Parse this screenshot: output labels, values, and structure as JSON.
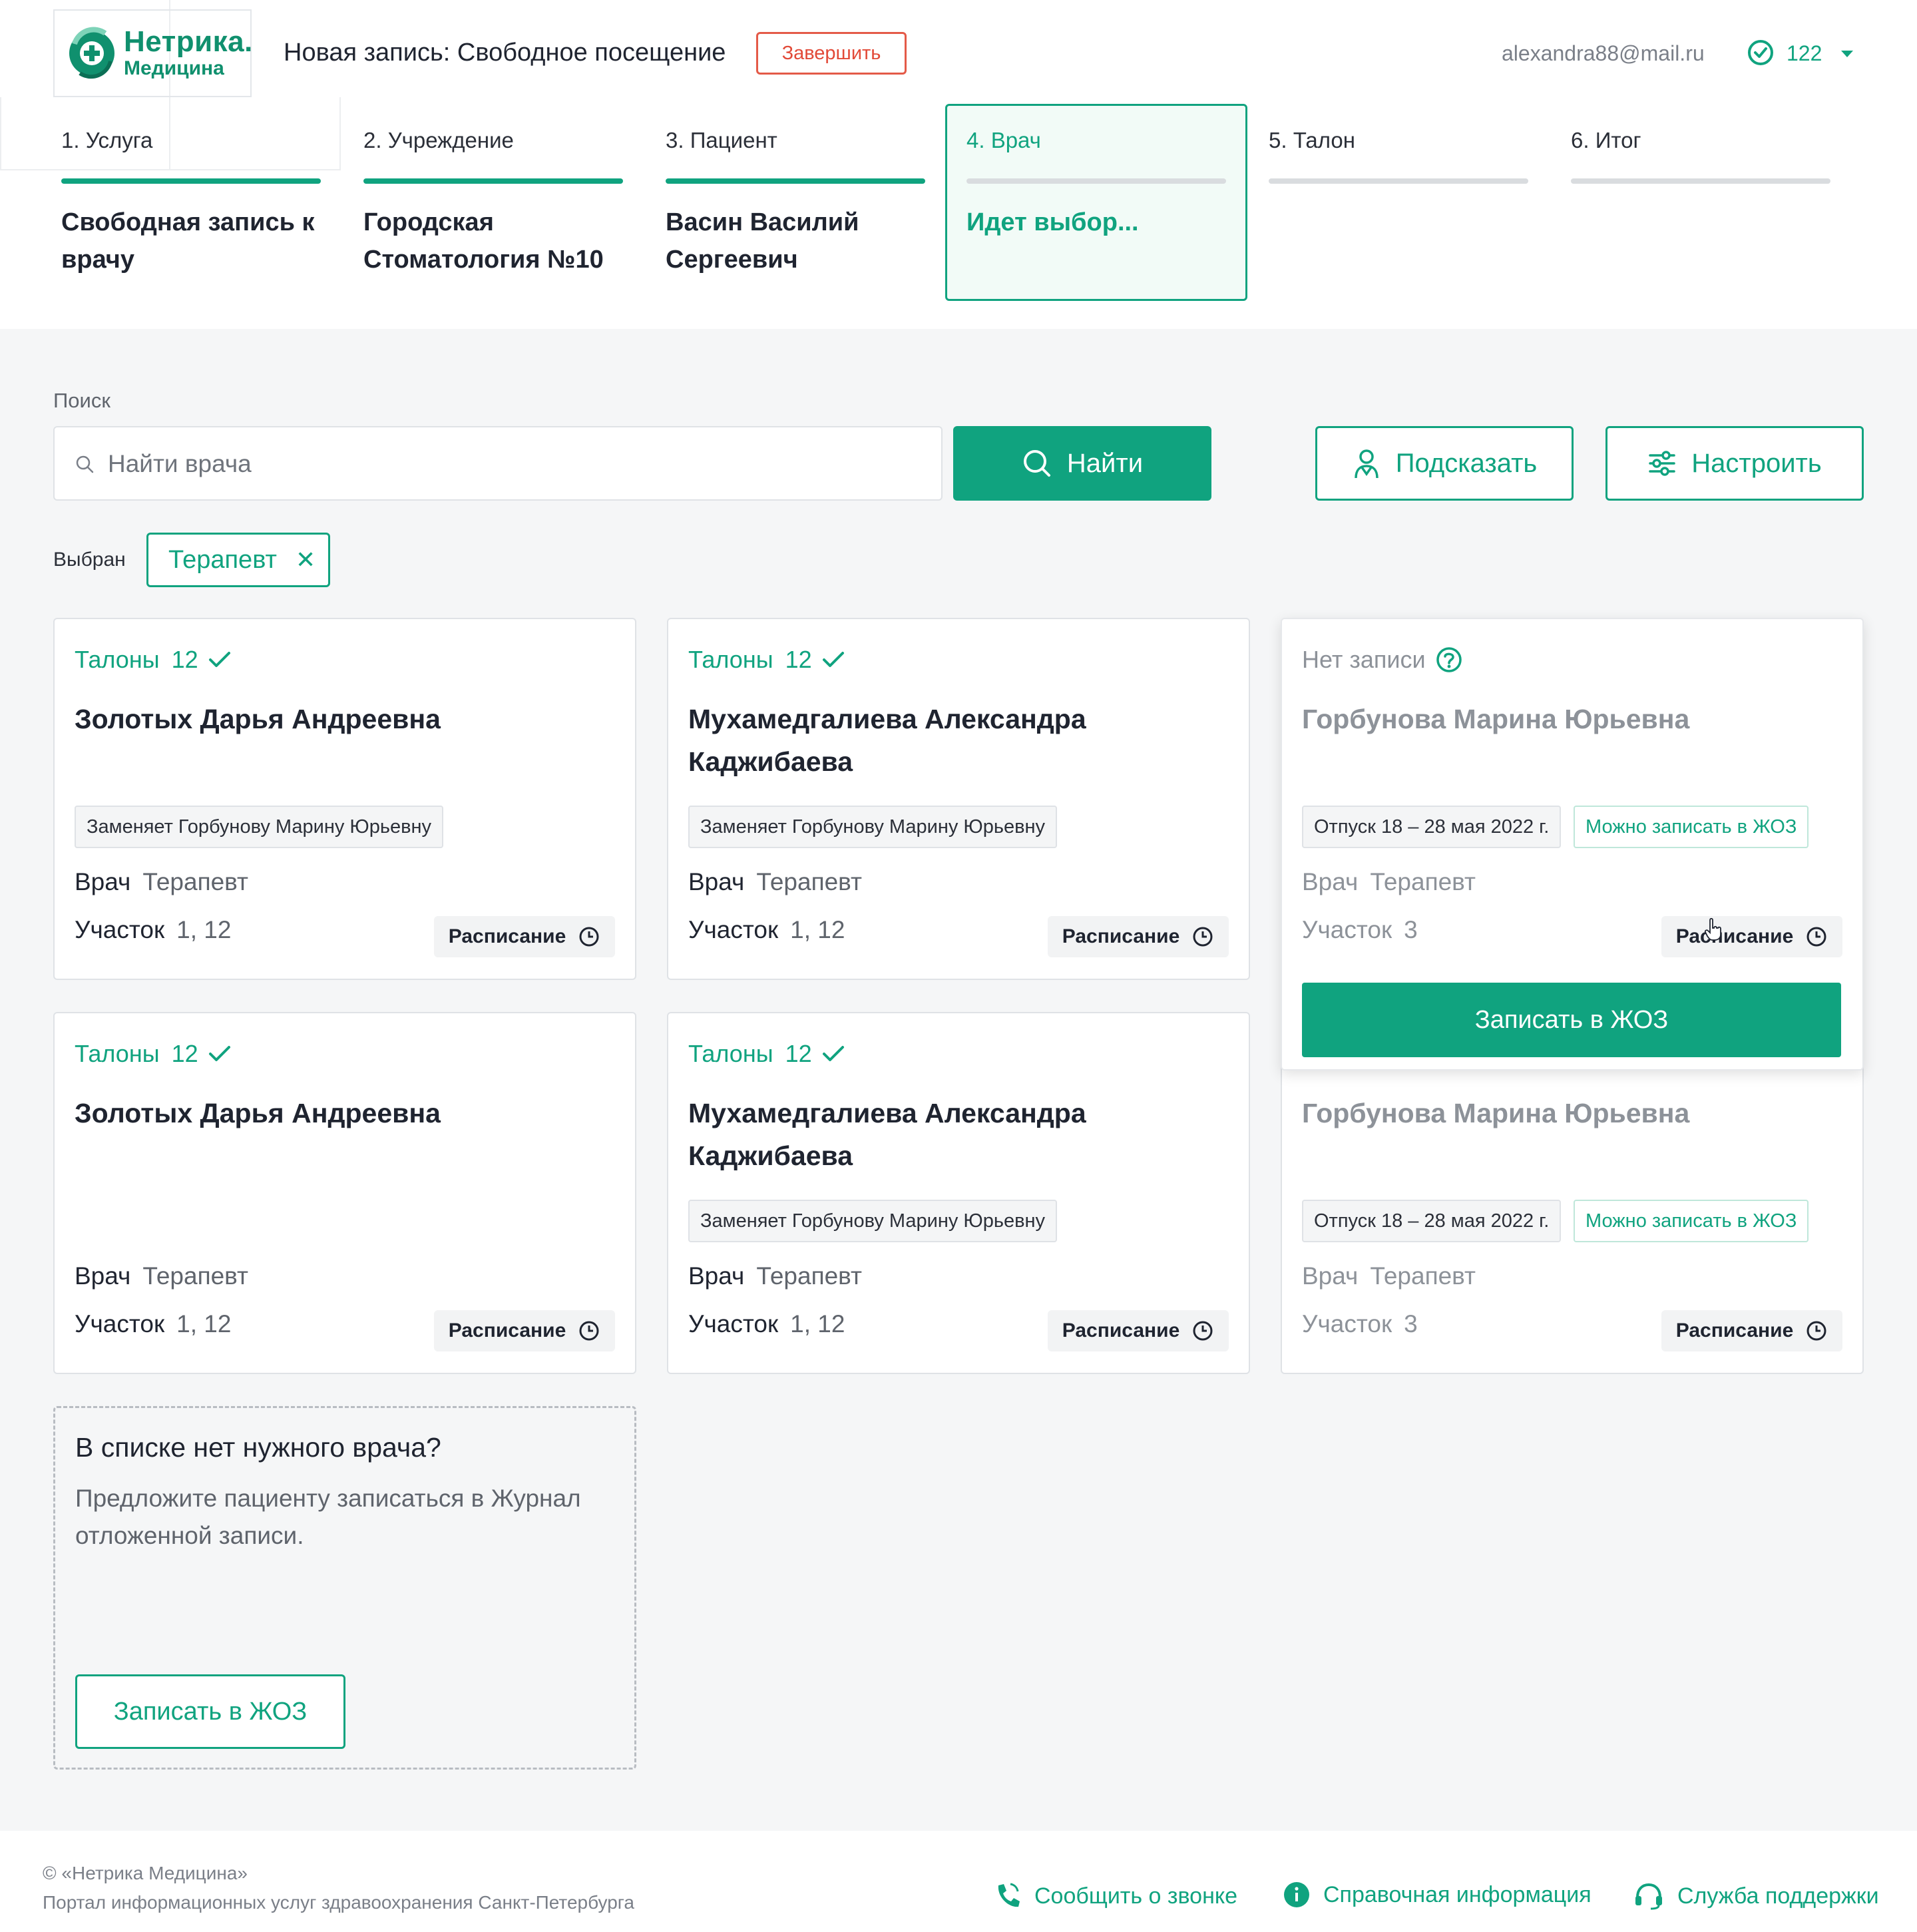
{
  "logo": {
    "line1": "Нетрика.",
    "line2": "Медицина"
  },
  "header": {
    "title": "Новая запись: Свободное посещение",
    "finish_label": "Завершить",
    "email": "alexandra88@mail.ru",
    "count": "122"
  },
  "steps": [
    {
      "label": "1. Услуга",
      "value": "Свободная запись к врачу",
      "state": "done"
    },
    {
      "label": "2. Учреждение",
      "value": "Городская Стоматология №10",
      "state": "done"
    },
    {
      "label": "3. Пациент",
      "value": "Васин Василий Сергеевич",
      "state": "done"
    },
    {
      "label": "4. Врач",
      "value": "Идет выбор...",
      "state": "active"
    },
    {
      "label": "5. Талон",
      "value": "",
      "state": "pending"
    },
    {
      "label": "6. Итог",
      "value": "",
      "state": "pending"
    }
  ],
  "search": {
    "label": "Поиск",
    "placeholder": "Найти врача",
    "find_label": "Найти",
    "suggest_label": "Подсказать",
    "configure_label": "Настроить"
  },
  "filter": {
    "label": "Выбран",
    "chip": "Терапевт"
  },
  "cards": [
    {
      "talon_label": "Талоны",
      "talon_count": "12",
      "name": "Золотых Дарья Андреевна",
      "tag": "Заменяет Горбунову Марину Юрьевну",
      "role_label": "Врач",
      "role": "Терапевт",
      "area_label": "Участок",
      "area": "1, 12",
      "schedule_label": "Расписание"
    },
    {
      "talon_label": "Талоны",
      "talon_count": "12",
      "name": "Мухамедгалиева Александра Каджибаева",
      "tag": "Заменяет Горбунову Марину Юрьевну",
      "role_label": "Врач",
      "role": "Терапевт",
      "area_label": "Участок",
      "area": "1, 12",
      "schedule_label": "Расписание"
    },
    {
      "status": "Нет записи",
      "name": "Горбунова Марина Юрьевна",
      "tag": "Отпуск 18 – 28 мая 2022 г.",
      "tag2": "Можно записать в ЖОЗ",
      "role_label": "Врач",
      "role": "Терапевт",
      "area_label": "Участок",
      "area": "3",
      "schedule_label": "Расписание",
      "action_label": "Записать в ЖОЗ"
    },
    {
      "talon_label": "Талоны",
      "talon_count": "12",
      "name": "Золотых Дарья Андреевна",
      "role_label": "Врач",
      "role": "Терапевт",
      "area_label": "Участок",
      "area": "1, 12",
      "schedule_label": "Расписание"
    },
    {
      "talon_label": "Талоны",
      "talon_count": "12",
      "name": "Мухамедгалиева Александра Каджибаева",
      "tag": "Заменяет Горбунову Марину Юрьевну",
      "role_label": "Врач",
      "role": "Терапевт",
      "area_label": "Участок",
      "area": "1, 12",
      "schedule_label": "Расписание"
    },
    {
      "name": "Горбунова Марина Юрьевна",
      "tag": "Отпуск 18 – 28 мая 2022 г.",
      "tag2": "Можно записать в ЖОЗ",
      "role_label": "Врач",
      "role": "Терапевт",
      "area_label": "Участок",
      "area": "3",
      "schedule_label": "Расписание"
    }
  ],
  "empty": {
    "title": "В списке нет нужного врача?",
    "text": "Предложите пациенту записаться в Журнал отложенной записи.",
    "action_label": "Записать в ЖОЗ"
  },
  "footer": {
    "copyright": "© «Нетрика Медицина»",
    "portal": "Портал информационных услуг здравоохранения Санкт-Петербурга",
    "link_call": "Сообщить о звонке",
    "link_info": "Справочная информация",
    "link_support": "Служба поддержки"
  },
  "colors": {
    "accent": "#10a37f",
    "danger": "#e24a38",
    "muted": "#8d9299"
  },
  "icons": [
    "logo-icon",
    "check-circle-icon",
    "chevron-down-icon",
    "search-icon",
    "doctor-icon",
    "sliders-icon",
    "close-icon",
    "check-icon",
    "question-icon",
    "clock-icon",
    "phone-icon",
    "info-icon",
    "headset-icon"
  ]
}
